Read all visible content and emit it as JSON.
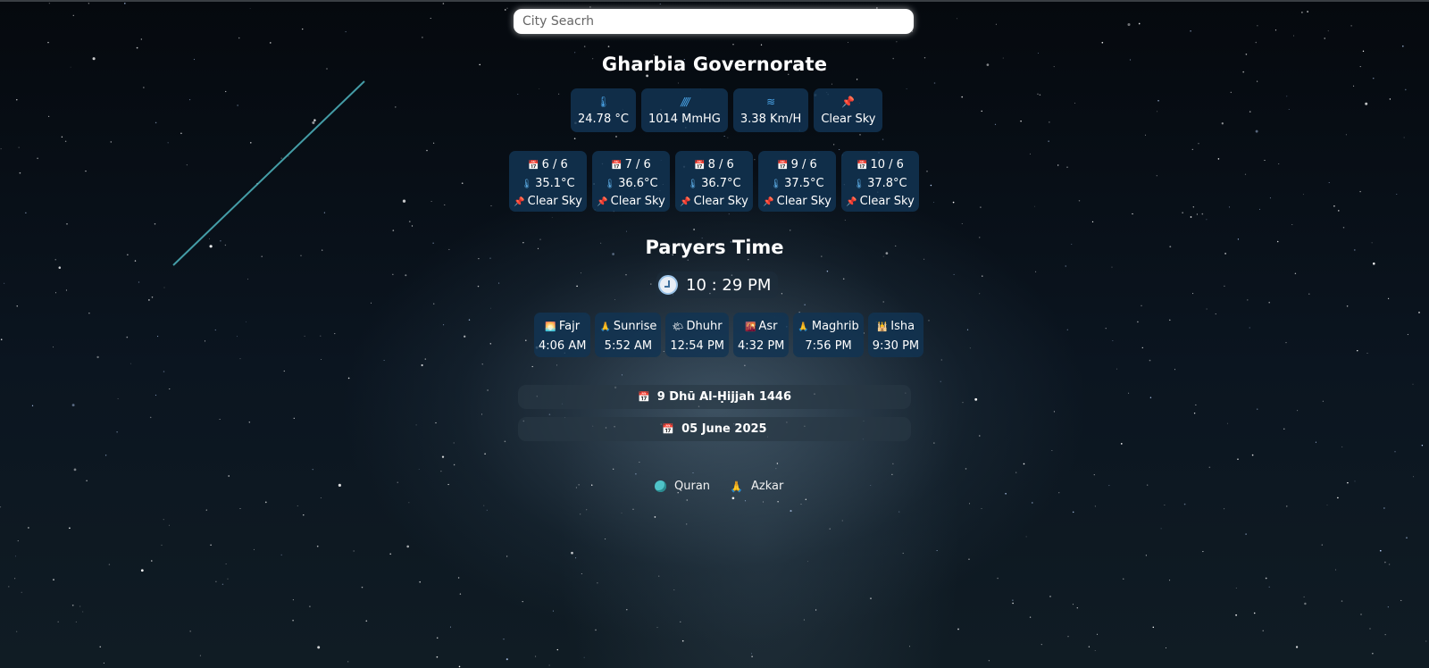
{
  "search": {
    "placeholder": "City Seacrh",
    "value": ""
  },
  "city": "Gharbia Governorate",
  "current": [
    {
      "icon": "thermometer-icon",
      "glyph": "🌡",
      "value": "24.78 °C"
    },
    {
      "icon": "pressure-icon",
      "glyph": "////",
      "value": "1014 MmHG"
    },
    {
      "icon": "wind-icon",
      "glyph": "≋",
      "value": "3.38 Km/H"
    },
    {
      "icon": "sky-icon",
      "glyph": "📌",
      "value": "Clear Sky"
    }
  ],
  "forecast": [
    {
      "date": "6 / 6",
      "temp": "35.1°C",
      "sky": "Clear Sky"
    },
    {
      "date": "7 / 6",
      "temp": "36.6°C",
      "sky": "Clear Sky"
    },
    {
      "date": "8 / 6",
      "temp": "36.7°C",
      "sky": "Clear Sky"
    },
    {
      "date": "9 / 6",
      "temp": "37.5°C",
      "sky": "Clear Sky"
    },
    {
      "date": "10 / 6",
      "temp": "37.8°C",
      "sky": "Clear Sky"
    }
  ],
  "prayers_title": "Paryers Time",
  "clock": "10 : 29 PM",
  "prayers": [
    {
      "name": "Fajr",
      "emoji": "🌅",
      "time": "4:06 AM"
    },
    {
      "name": "Sunrise",
      "emoji": "🙏",
      "time": "5:52 AM"
    },
    {
      "name": "Dhuhr",
      "emoji": "🌤",
      "time": "12:54 PM"
    },
    {
      "name": "Asr",
      "emoji": "🌇",
      "time": "4:32 PM"
    },
    {
      "name": "Maghrib",
      "emoji": "🙏",
      "time": "7:56 PM"
    },
    {
      "name": "Isha",
      "emoji": "🕌",
      "time": "9:30 PM"
    }
  ],
  "hijri_date": "9 Dhū Al-Ḥijjah 1446",
  "gregorian_date": "05 June 2025",
  "links": [
    {
      "label": "Quran",
      "icon": "quran-icon"
    },
    {
      "label": "Azkar",
      "icon": "azkar-icon"
    }
  ]
}
